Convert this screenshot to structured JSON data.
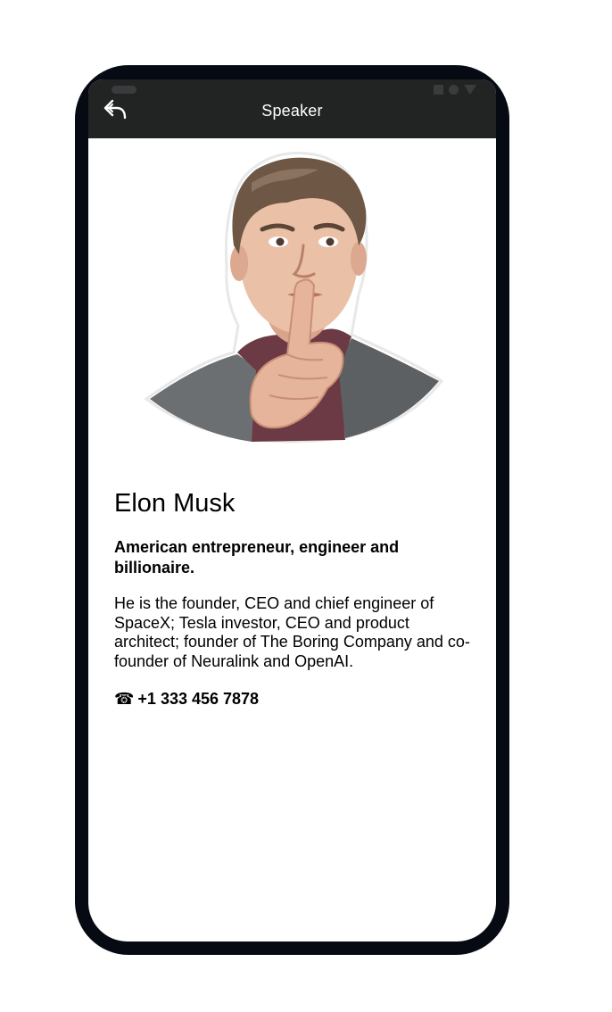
{
  "appbar": {
    "title": "Speaker",
    "back_icon": "back-arrow-icon"
  },
  "speaker": {
    "name": "Elon Musk",
    "subtitle": "American entrepreneur, engineer and billionaire.",
    "bio": "He is the founder, CEO and chief engineer of SpaceX; Tesla investor, CEO and product architect; founder of The Boring Company and co-founder of Neuralink and OpenAI.",
    "phone_icon": "☎",
    "phone": "+1 333 456 7878"
  },
  "colors": {
    "appbar_bg": "#222323",
    "frame": "#060a12",
    "text": "#000000"
  }
}
